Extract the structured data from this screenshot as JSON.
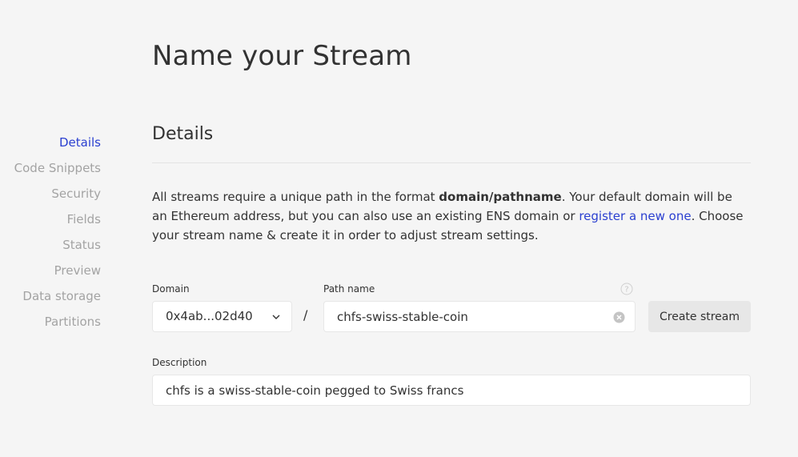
{
  "page": {
    "title": "Name your Stream"
  },
  "nav": {
    "items": [
      {
        "label": "Details",
        "active": true
      },
      {
        "label": "Code Snippets",
        "active": false
      },
      {
        "label": "Security",
        "active": false
      },
      {
        "label": "Fields",
        "active": false
      },
      {
        "label": "Status",
        "active": false
      },
      {
        "label": "Preview",
        "active": false
      },
      {
        "label": "Data storage",
        "active": false
      },
      {
        "label": "Partitions",
        "active": false
      }
    ]
  },
  "details": {
    "title": "Details",
    "intro_part1": "All streams require a unique path in the format ",
    "intro_bold": "domain/pathname",
    "intro_part2": ". Your default domain will be an Ethereum address, but you can also use an existing ENS domain or ",
    "intro_link": "register a new one",
    "intro_part3": ". Choose your stream name & create it in order to adjust stream settings."
  },
  "form": {
    "domain_label": "Domain",
    "domain_value": "0x4ab...02d40",
    "separator": "/",
    "path_label": "Path name",
    "path_value": "chfs-swiss-stable-coin",
    "create_button": "Create stream",
    "description_label": "Description",
    "description_value": "chfs is a swiss-stable-coin pegged to Swiss francs"
  },
  "icons": {
    "domain_dropdown": "chevron-down-icon",
    "path_clear": "clear-icon",
    "path_help": "help-icon"
  },
  "colors": {
    "accent": "#2a3fd0",
    "background": "#f5f5f5",
    "muted_text": "#a3a3a3"
  }
}
